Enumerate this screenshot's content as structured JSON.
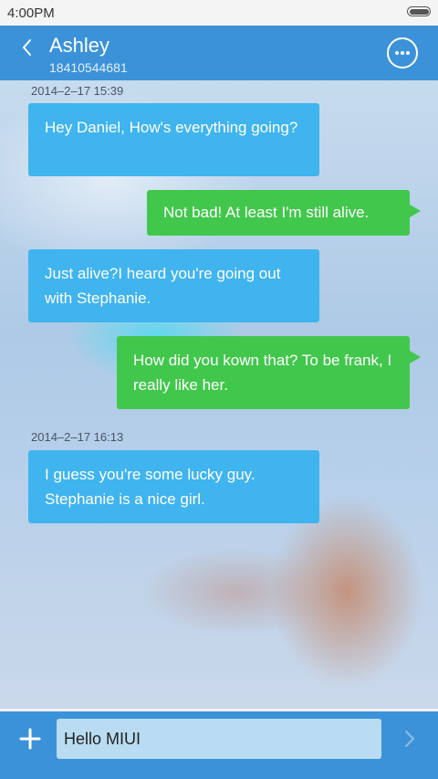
{
  "status_bar": {
    "time": "4:00PM",
    "battery_icon": "battery-icon"
  },
  "header": {
    "back_icon": "chevron-left-icon",
    "contact_name": "Ashley",
    "contact_number": "18410544681",
    "more_icon": "more-dots-icon"
  },
  "conversation": {
    "timestamps": [
      "2014–2–17 15:39",
      "2014–2–17 16:13"
    ],
    "messages": [
      {
        "direction": "incoming",
        "text": "Hey Daniel, How's everything going?"
      },
      {
        "direction": "outgoing",
        "text": "Not bad! At least I'm still alive."
      },
      {
        "direction": "incoming",
        "text": "Just  alive?I heard you're going out with Stephanie."
      },
      {
        "direction": "outgoing",
        "text": "How did you kown that? To be frank, I really like her."
      },
      {
        "direction": "incoming",
        "text": "I guess you're some lucky guy. Stephanie is a nice girl."
      }
    ]
  },
  "composer": {
    "add_icon": "plus-icon",
    "input_value": "Hello MIUI",
    "send_icon": "chevron-right-icon"
  },
  "colors": {
    "header": "#3b92d8",
    "incoming_bubble": "#40b4ee",
    "outgoing_bubble": "#42c74d",
    "input_field": "#b9dcf2"
  }
}
